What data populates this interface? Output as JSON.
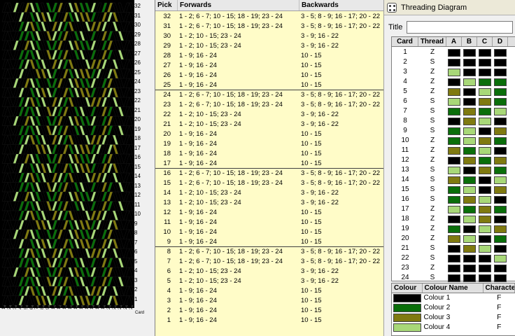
{
  "colors": {
    "c1": "#000000",
    "c2": "#0a6e0a",
    "c3": "#7f7a10",
    "c4": "#a8d878",
    "pick_bg": "#fffcc8"
  },
  "pattern": {
    "card_label": "Card",
    "pick_labels": [
      "32",
      "31",
      "30",
      "29",
      "28",
      "27",
      "26",
      "25",
      "24",
      "23",
      "22",
      "21",
      "20",
      "19",
      "18",
      "17",
      "16",
      "15",
      "14",
      "13",
      "12",
      "11",
      "10",
      "9",
      "8",
      "7",
      "6",
      "5",
      "4",
      "3",
      "2",
      "1"
    ],
    "card_labels": [
      "1",
      "2",
      "3",
      "4",
      "5",
      "6",
      "7",
      "8",
      "9",
      "10",
      "11",
      "12",
      "13",
      "14",
      "15",
      "16",
      "17",
      "18",
      "19",
      "20",
      "21",
      "22",
      "23",
      "24"
    ]
  },
  "picks": {
    "headers": {
      "pick": "Pick",
      "forwards": "Forwards",
      "backwards": "Backwards"
    },
    "rows": [
      {
        "pick": "32",
        "fwd": "1 - 2; 6 - 7; 10 - 15; 18 - 19; 23 - 24",
        "bwd": "3 - 5; 8 - 9; 16 - 17; 20 - 22"
      },
      {
        "pick": "31",
        "fwd": "1 - 2; 6 - 7; 10 - 15; 18 - 19; 23 - 24",
        "bwd": "3 - 5; 8 - 9; 16 - 17; 20 - 22"
      },
      {
        "pick": "30",
        "fwd": "1 - 2; 10 - 15; 23 - 24",
        "bwd": "3 - 9; 16 - 22"
      },
      {
        "pick": "29",
        "fwd": "1 - 2; 10 - 15; 23 - 24",
        "bwd": "3 - 9; 16 - 22"
      },
      {
        "pick": "28",
        "fwd": "1 - 9; 16 - 24",
        "bwd": "10 - 15"
      },
      {
        "pick": "27",
        "fwd": "1 - 9; 16 - 24",
        "bwd": "10 - 15"
      },
      {
        "pick": "26",
        "fwd": "1 - 9; 16 - 24",
        "bwd": "10 - 15"
      },
      {
        "pick": "25",
        "fwd": "1 - 9; 16 - 24",
        "bwd": "10 - 15"
      },
      {
        "pick": "24",
        "fwd": "1 - 2; 6 - 7; 10 - 15; 18 - 19; 23 - 24",
        "bwd": "3 - 5; 8 - 9; 16 - 17; 20 - 22"
      },
      {
        "pick": "23",
        "fwd": "1 - 2; 6 - 7; 10 - 15; 18 - 19; 23 - 24",
        "bwd": "3 - 5; 8 - 9; 16 - 17; 20 - 22"
      },
      {
        "pick": "22",
        "fwd": "1 - 2; 10 - 15; 23 - 24",
        "bwd": "3 - 9; 16 - 22"
      },
      {
        "pick": "21",
        "fwd": "1 - 2; 10 - 15; 23 - 24",
        "bwd": "3 - 9; 16 - 22"
      },
      {
        "pick": "20",
        "fwd": "1 - 9; 16 - 24",
        "bwd": "10 - 15"
      },
      {
        "pick": "19",
        "fwd": "1 - 9; 16 - 24",
        "bwd": "10 - 15"
      },
      {
        "pick": "18",
        "fwd": "1 - 9; 16 - 24",
        "bwd": "10 - 15"
      },
      {
        "pick": "17",
        "fwd": "1 - 9; 16 - 24",
        "bwd": "10 - 15"
      },
      {
        "pick": "16",
        "fwd": "1 - 2; 6 - 7; 10 - 15; 18 - 19; 23 - 24",
        "bwd": "3 - 5; 8 - 9; 16 - 17; 20 - 22"
      },
      {
        "pick": "15",
        "fwd": "1 - 2; 6 - 7; 10 - 15; 18 - 19; 23 - 24",
        "bwd": "3 - 5; 8 - 9; 16 - 17; 20 - 22"
      },
      {
        "pick": "14",
        "fwd": "1 - 2; 10 - 15; 23 - 24",
        "bwd": "3 - 9; 16 - 22"
      },
      {
        "pick": "13",
        "fwd": "1 - 2; 10 - 15; 23 - 24",
        "bwd": "3 - 9; 16 - 22"
      },
      {
        "pick": "12",
        "fwd": "1 - 9; 16 - 24",
        "bwd": "10 - 15"
      },
      {
        "pick": "11",
        "fwd": "1 - 9; 16 - 24",
        "bwd": "10 - 15"
      },
      {
        "pick": "10",
        "fwd": "1 - 9; 16 - 24",
        "bwd": "10 - 15"
      },
      {
        "pick": "9",
        "fwd": "1 - 9; 16 - 24",
        "bwd": "10 - 15"
      },
      {
        "pick": "8",
        "fwd": "1 - 2; 6 - 7; 10 - 15; 18 - 19; 23 - 24",
        "bwd": "3 - 5; 8 - 9; 16 - 17; 20 - 22"
      },
      {
        "pick": "7",
        "fwd": "1 - 2; 6 - 7; 10 - 15; 18 - 19; 23 - 24",
        "bwd": "3 - 5; 8 - 9; 16 - 17; 20 - 22"
      },
      {
        "pick": "6",
        "fwd": "1 - 2; 10 - 15; 23 - 24",
        "bwd": "3 - 9; 16 - 22"
      },
      {
        "pick": "5",
        "fwd": "1 - 2; 10 - 15; 23 - 24",
        "bwd": "3 - 9; 16 - 22"
      },
      {
        "pick": "4",
        "fwd": "1 - 9; 16 - 24",
        "bwd": "10 - 15"
      },
      {
        "pick": "3",
        "fwd": "1 - 9; 16 - 24",
        "bwd": "10 - 15"
      },
      {
        "pick": "2",
        "fwd": "1 - 9; 16 - 24",
        "bwd": "10 - 15"
      },
      {
        "pick": "1",
        "fwd": "1 - 9; 16 - 24",
        "bwd": "10 - 15"
      }
    ]
  },
  "threading": {
    "window_title": "Threading Diagram",
    "title_label": "Title",
    "title_value": "",
    "headers": {
      "card": "Card",
      "thread": "Thread",
      "a": "A",
      "b": "B",
      "c": "C",
      "d": "D"
    },
    "cards": [
      {
        "card": "1",
        "thread": "Z",
        "holes": [
          "c1",
          "c1",
          "c1",
          "c1"
        ]
      },
      {
        "card": "2",
        "thread": "S",
        "holes": [
          "c1",
          "c1",
          "c1",
          "c1"
        ]
      },
      {
        "card": "3",
        "thread": "Z",
        "holes": [
          "c4",
          "c1",
          "c1",
          "c1"
        ]
      },
      {
        "card": "4",
        "thread": "Z",
        "holes": [
          "c1",
          "c4",
          "c2",
          "c2"
        ]
      },
      {
        "card": "5",
        "thread": "Z",
        "holes": [
          "c3",
          "c1",
          "c4",
          "c2"
        ]
      },
      {
        "card": "6",
        "thread": "S",
        "holes": [
          "c4",
          "c1",
          "c3",
          "c2"
        ]
      },
      {
        "card": "7",
        "thread": "S",
        "holes": [
          "c2",
          "c3",
          "c2",
          "c4"
        ]
      },
      {
        "card": "8",
        "thread": "S",
        "holes": [
          "c1",
          "c3",
          "c4",
          "c1"
        ]
      },
      {
        "card": "9",
        "thread": "S",
        "holes": [
          "c2",
          "c4",
          "c1",
          "c3"
        ]
      },
      {
        "card": "10",
        "thread": "Z",
        "holes": [
          "c2",
          "c4",
          "c3",
          "c2"
        ]
      },
      {
        "card": "11",
        "thread": "Z",
        "holes": [
          "c3",
          "c2",
          "c4",
          "c1"
        ]
      },
      {
        "card": "12",
        "thread": "Z",
        "holes": [
          "c1",
          "c3",
          "c2",
          "c3"
        ]
      },
      {
        "card": "13",
        "thread": "S",
        "holes": [
          "c4",
          "c1",
          "c3",
          "c2"
        ]
      },
      {
        "card": "14",
        "thread": "S",
        "holes": [
          "c3",
          "c2",
          "c1",
          "c4"
        ]
      },
      {
        "card": "15",
        "thread": "S",
        "holes": [
          "c2",
          "c4",
          "c1",
          "c3"
        ]
      },
      {
        "card": "16",
        "thread": "S",
        "holes": [
          "c2",
          "c3",
          "c4",
          "c1"
        ]
      },
      {
        "card": "17",
        "thread": "Z",
        "holes": [
          "c4",
          "c2",
          "c3",
          "c2"
        ]
      },
      {
        "card": "18",
        "thread": "Z",
        "holes": [
          "c1",
          "c4",
          "c3",
          "c1"
        ]
      },
      {
        "card": "19",
        "thread": "Z",
        "holes": [
          "c2",
          "c1",
          "c4",
          "c3"
        ]
      },
      {
        "card": "20",
        "thread": "Z",
        "holes": [
          "c3",
          "c4",
          "c1",
          "c2"
        ]
      },
      {
        "card": "21",
        "thread": "S",
        "holes": [
          "c1",
          "c3",
          "c4",
          "c1"
        ]
      },
      {
        "card": "22",
        "thread": "S",
        "holes": [
          "c1",
          "c1",
          "c1",
          "c4"
        ]
      },
      {
        "card": "23",
        "thread": "Z",
        "holes": [
          "c1",
          "c1",
          "c1",
          "c1"
        ]
      },
      {
        "card": "24",
        "thread": "S",
        "holes": [
          "c1",
          "c1",
          "c1",
          "c1"
        ]
      }
    ],
    "colour_headers": {
      "colour": "Colour",
      "name": "Colour Name",
      "character": "Character"
    },
    "colours": [
      {
        "key": "c1",
        "name": "Colour 1",
        "char": "F"
      },
      {
        "key": "c2",
        "name": "Colour 2",
        "char": "F"
      },
      {
        "key": "c3",
        "name": "Colour 3",
        "char": "F"
      },
      {
        "key": "c4",
        "name": "Colour 4",
        "char": "F"
      }
    ]
  }
}
